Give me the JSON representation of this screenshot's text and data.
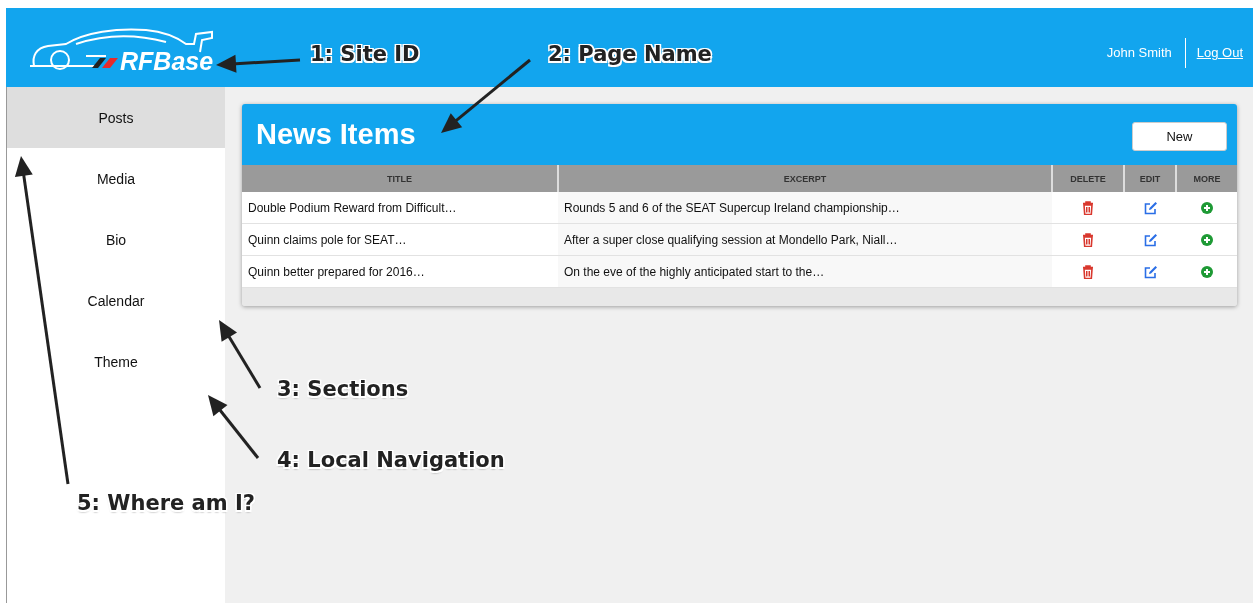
{
  "header": {
    "logo_text": "RFBase",
    "user_name": "John Smith",
    "logout_link": "Log Out"
  },
  "sidebar": {
    "items": [
      {
        "label": "Posts",
        "selected": true
      },
      {
        "label": "Media",
        "selected": false
      },
      {
        "label": "Bio",
        "selected": false
      },
      {
        "label": "Calendar",
        "selected": false
      },
      {
        "label": "Theme",
        "selected": false
      }
    ]
  },
  "panel": {
    "title": "News Items",
    "new_button": "New",
    "table": {
      "columns": [
        "TITLE",
        "EXCERPT",
        "DELETE",
        "EDIT",
        "MORE"
      ],
      "rows": [
        {
          "title": "Double Podium Reward from Difficult…",
          "excerpt": "Rounds 5 and 6 of the SEAT Supercup Ireland championship…"
        },
        {
          "title": "Quinn claims pole for SEAT…",
          "excerpt": "After a super close qualifying session at Mondello Park, Niall…"
        },
        {
          "title": "Quinn better prepared for 2016…",
          "excerpt": "On the eve of the highly anticipated start to the…"
        }
      ]
    }
  },
  "annotations": [
    "1: Site ID",
    "2: Page Name",
    "3: Sections",
    "4: Local Navigation",
    "5: Where am I?"
  ]
}
